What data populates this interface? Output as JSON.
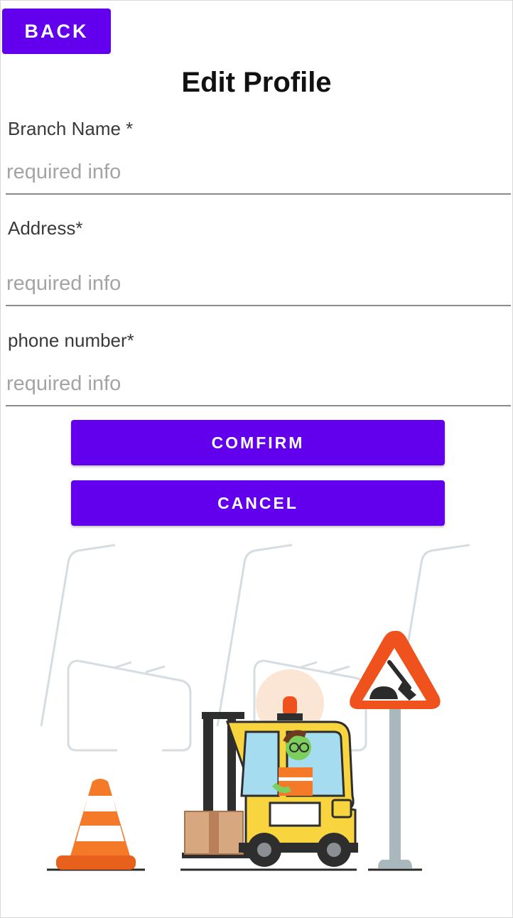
{
  "header": {
    "back_label": "BACK",
    "title": "Edit Profile"
  },
  "form": {
    "fields": [
      {
        "label": "Branch Name *",
        "placeholder": "required info",
        "value": ""
      },
      {
        "label": "Address*",
        "placeholder": "required info",
        "value": ""
      },
      {
        "label": "phone number*",
        "placeholder": "required info",
        "value": ""
      }
    ]
  },
  "actions": {
    "confirm_label": "COMFIRM",
    "cancel_label": "CANCEL"
  },
  "colors": {
    "primary": "#6200ee",
    "underline": "#8a8a8a",
    "placeholder": "#a4a4a4"
  },
  "illustration": {
    "icons": [
      "traffic-cone-icon",
      "forklift-icon",
      "warning-sign-icon",
      "box-icon",
      "shovel-icon"
    ]
  }
}
